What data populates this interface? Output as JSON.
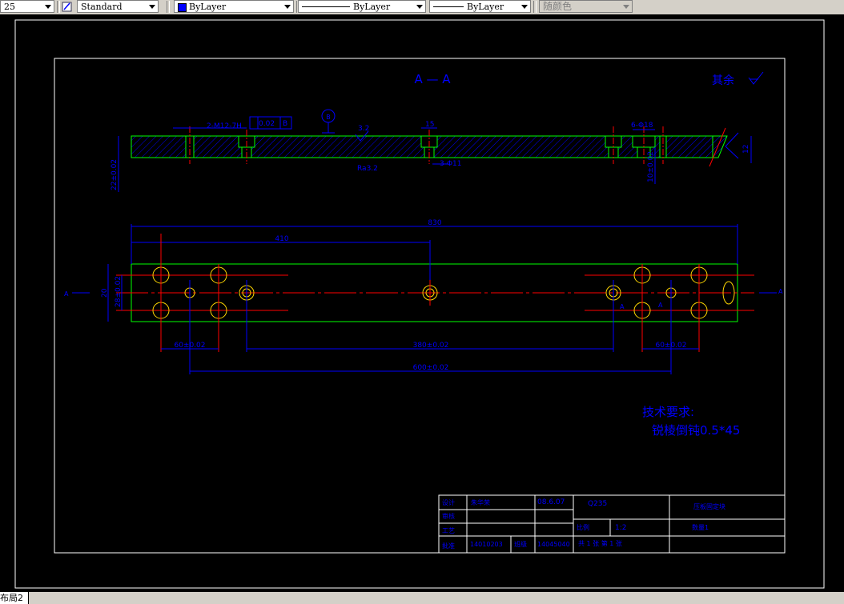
{
  "toolbar": {
    "scale_value": "25",
    "text_style": "Standard",
    "layer_color": "ByLayer",
    "linetype": "ByLayer",
    "lineweight": "ByLayer",
    "plot_style": "随颜色"
  },
  "drawing": {
    "section_title": "A — A",
    "roughness_note": "其余",
    "tech_req_title": "技术要求:",
    "tech_req_item": "锐棱倒钝0.5*45",
    "dim_hole_callout": "2-M12-7H",
    "dim_tolerance": "0.02",
    "datum_b": "B",
    "dim_top_15": "15",
    "dim_32": "3.2",
    "dim_ru2": "Ra3.2",
    "dim_3_11": "3-Φ11",
    "dim_6_18": "6-Φ18",
    "dim_12": "12",
    "dim_22": "22±0.02",
    "dim_10": "10±0.02",
    "dim_830": "830",
    "dim_410": "410",
    "dim_60_left": "60±0.02",
    "dim_380": "380±0.02",
    "dim_60_right": "60±0.02",
    "dim_600": "600±0.02",
    "dim_v_20": "20",
    "dim_v_28": "28±0.02",
    "sec_left": "A",
    "sec_right": "A",
    "sec_mid": "A",
    "sec_mid2": "A"
  },
  "title_block": {
    "designer_label": "设计",
    "designer_name": "朱华荣",
    "date": "08.6.07",
    "material": "Q235",
    "part_name": "压板固定块",
    "review_label": "审核",
    "process_label": "工艺",
    "scale_label": "比例",
    "scale_value": "1:2",
    "qty_label": "数量",
    "qty_value": "1",
    "approve_label": "批准",
    "student_id": "14010203",
    "class_label": "班级",
    "class_value": "14045040",
    "sheet_info": "共 1 张  第 1 张"
  },
  "status": {
    "layout_tab": "布局2"
  },
  "colors": {
    "outline": "#00ff00",
    "dimension": "#0000ff",
    "centerline": "#ff0000",
    "hatch": "#0000ff",
    "frame": "#ffffff",
    "gold": "#ffd700"
  }
}
